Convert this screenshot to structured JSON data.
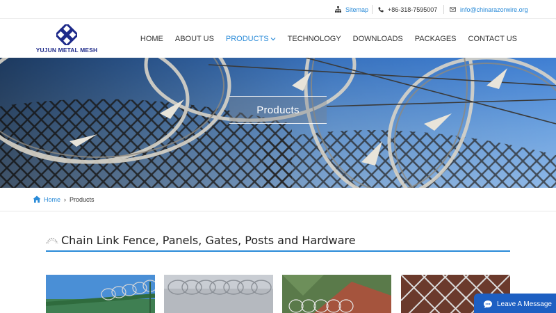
{
  "topbar": {
    "sitemap": "Sitemap",
    "phone": "+86-318-7595007",
    "email": "info@chinarazorwire.org"
  },
  "brand": {
    "name": "YUJUN METAL MESH",
    "color": "#1e2a8a"
  },
  "nav": [
    {
      "label": "HOME",
      "active": false
    },
    {
      "label": "ABOUT US",
      "active": false
    },
    {
      "label": "PRODUCTS",
      "active": true
    },
    {
      "label": "TECHNOLOGY",
      "active": false
    },
    {
      "label": "DOWNLOADS",
      "active": false
    },
    {
      "label": "PACKAGES",
      "active": false
    },
    {
      "label": "CONTACT US",
      "active": false
    }
  ],
  "banner": {
    "title": "Products"
  },
  "breadcrumb": {
    "home": "Home",
    "current": "Products"
  },
  "section": {
    "title": "Chain Link Fence, Panels, Gates, Posts and Hardware"
  },
  "chat": {
    "label": "Leave A Message"
  },
  "colors": {
    "accent": "#2a8bd8",
    "chat_bg": "#1d5fc2"
  }
}
